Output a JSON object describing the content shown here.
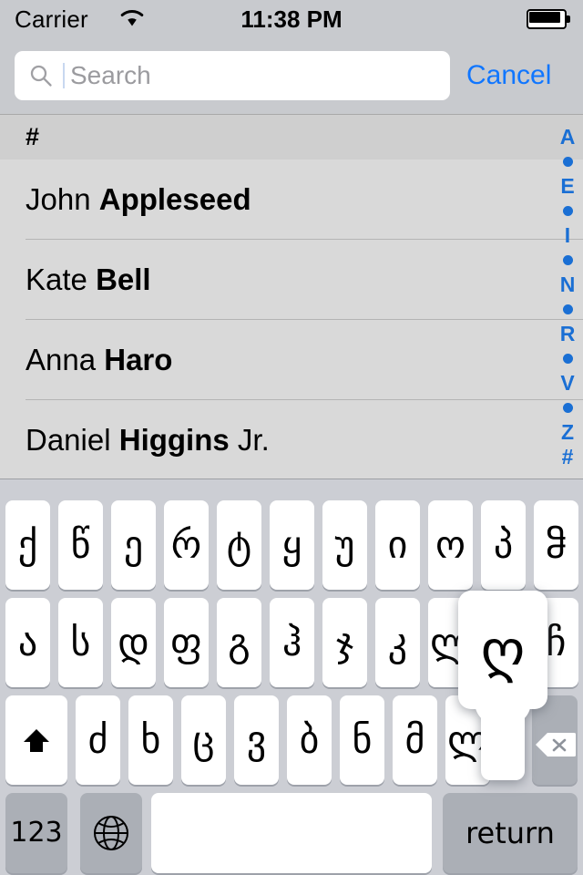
{
  "status_bar": {
    "carrier": "Carrier",
    "wifi_icon": "wifi-icon",
    "time": "11:38 PM",
    "battery_icon": "battery-full-icon"
  },
  "search": {
    "icon": "search-icon",
    "placeholder": "Search",
    "value": "",
    "cancel_label": "Cancel",
    "accent_color": "#1076ff"
  },
  "list": {
    "section_header": "#",
    "contacts": [
      {
        "first": "John ",
        "last": "Appleseed",
        "suffix": ""
      },
      {
        "first": "Kate ",
        "last": "Bell",
        "suffix": ""
      },
      {
        "first": "Anna ",
        "last": "Haro",
        "suffix": ""
      },
      {
        "first": "Daniel ",
        "last": "Higgins",
        "suffix": " Jr."
      }
    ]
  },
  "index_bar": {
    "color": "#1a6fd4",
    "entries": [
      "A",
      "•",
      "E",
      "•",
      "I",
      "•",
      "N",
      "•",
      "R",
      "•",
      "V",
      "•",
      "Z",
      "#"
    ]
  },
  "keyboard": {
    "language": "Georgian",
    "row1": [
      "ქ",
      "წ",
      "ე",
      "რ",
      "ტ",
      "ყ",
      "უ",
      "ი",
      "ო",
      "პ",
      "ჵ"
    ],
    "row2": [
      "ა",
      "ს",
      "დ",
      "ფ",
      "გ",
      "ჰ",
      "ჯ",
      "კ",
      "ლ",
      "ღ",
      "ჩ"
    ],
    "row2_popup_char": "ღ",
    "row3": [
      "ძ",
      "ხ",
      "ც",
      "ვ",
      "ბ",
      "ნ",
      "მ",
      "ლ"
    ],
    "shift_icon": "shift-icon",
    "backspace_icon": "backspace-icon",
    "numbers_label": "123",
    "globe_icon": "globe-icon",
    "space_label": "",
    "return_label": "return"
  }
}
